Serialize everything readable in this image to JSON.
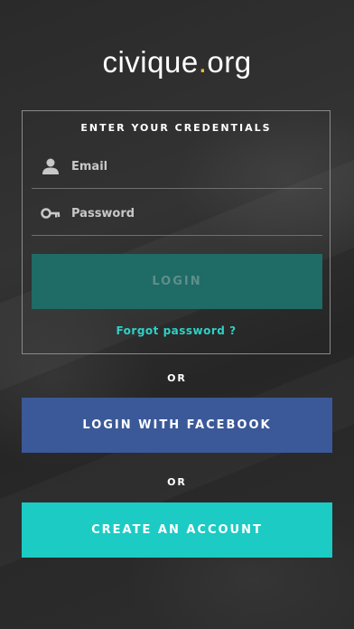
{
  "logo": {
    "part1": "civ",
    "dot1": "i",
    "part2": "que",
    "dot2": ".",
    "part3": "org"
  },
  "form": {
    "title": "ENTER YOUR CREDENTIALS",
    "email_placeholder": "Email",
    "password_placeholder": "Password",
    "login_label": "LOGIN",
    "forgot_label": "Forgot password ?"
  },
  "separators": {
    "or_1": "OR",
    "or_2": "OR"
  },
  "social": {
    "facebook_label": "LOGIN WITH FACEBOOK"
  },
  "signup": {
    "create_label": "CREATE AN ACCOUNT"
  },
  "colors": {
    "brand_teal": "#1bcbc4",
    "facebook_blue": "#3b5998",
    "login_disabled": "#1f6b66",
    "link_teal": "#2ed1c6",
    "logo_accent": "#f2c12e"
  },
  "icons": {
    "email": "user-icon",
    "password": "key-icon"
  }
}
